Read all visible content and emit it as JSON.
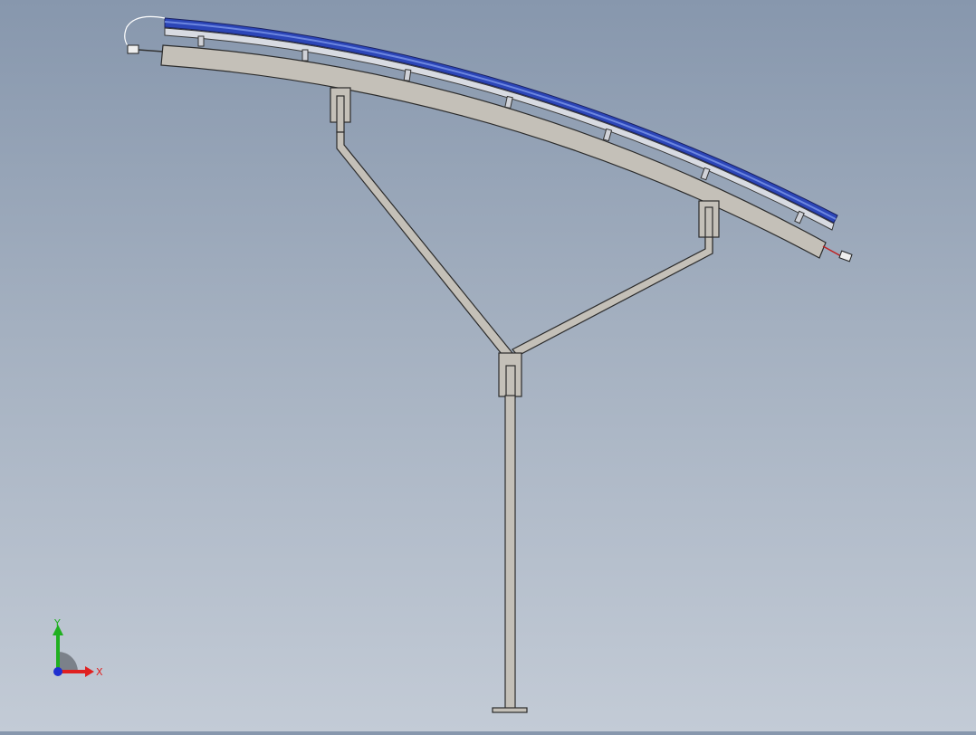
{
  "viewport": {
    "background_top": "#8797ad",
    "background_bottom": "#c3cbd6",
    "model": {
      "frame_color": "#c4c0b8",
      "frame_stroke": "#2b2b2b",
      "panel_color": "#2c46b8",
      "panel_highlight": "#6c86e0",
      "rail_color": "#d8dbe2",
      "wire_color": "#c02020"
    }
  },
  "triad": {
    "x_label": "X",
    "y_label": "Y",
    "x_color": "#e02020",
    "y_color": "#20b020",
    "z_color": "#2030d0"
  }
}
